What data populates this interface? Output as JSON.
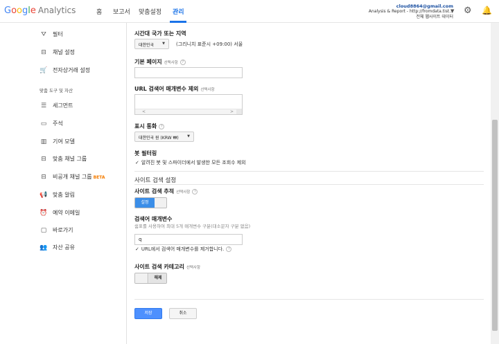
{
  "app": {
    "logo_google": [
      "G",
      "o",
      "o",
      "g",
      "l",
      "e"
    ],
    "product": "Analytics"
  },
  "nav": {
    "home": "홈",
    "reports": "보고서",
    "customization": "맞춤설정",
    "admin": "관리"
  },
  "account": {
    "email": "cloud8864@gmail.com",
    "line2": "Analysis & Report - http://fromdata.tist...",
    "line3": "전체 웹사이트 데이터"
  },
  "sidebar": {
    "items_top": [
      {
        "label": "필터",
        "icon": "filter-icon",
        "glyph": "⛛"
      },
      {
        "label": "채널 설정",
        "icon": "channel-icon",
        "glyph": "⊟"
      },
      {
        "label": "전자상거래 설정",
        "icon": "cart-icon",
        "glyph": "🛒"
      }
    ],
    "section_header": "맞춤 도구 및 자산",
    "items_bottom": [
      {
        "label": "세그먼트",
        "icon": "segment-icon",
        "glyph": "☰"
      },
      {
        "label": "주석",
        "icon": "annotation-icon",
        "glyph": "▭"
      },
      {
        "label": "기여 모델",
        "icon": "attribution-icon",
        "glyph": "▥"
      },
      {
        "label": "맞춤 채널 그룹",
        "icon": "channel-group-icon",
        "glyph": "⊟"
      },
      {
        "label": "비공개 채널 그룹",
        "icon": "private-channel-icon",
        "glyph": "⊟",
        "badge": "BETA"
      },
      {
        "label": "맞춤 알림",
        "icon": "alert-icon",
        "glyph": "📢"
      },
      {
        "label": "예약 이메일",
        "icon": "clock-icon",
        "glyph": "⏰"
      },
      {
        "label": "바로가기",
        "icon": "shortcut-icon",
        "glyph": "▢"
      },
      {
        "label": "자산 공유",
        "icon": "share-icon",
        "glyph": "👥"
      }
    ]
  },
  "form": {
    "timezone": {
      "label": "시간대 국가 또는 지역",
      "country": "대한민국",
      "zone": "(그리니치 표준시 +09:00) 서울"
    },
    "default_page": {
      "label": "기본 페이지",
      "optional": "선택사항",
      "value": ""
    },
    "exclude_params": {
      "label": "URL 검색어 매개변수 제외",
      "optional": "선택사항"
    },
    "currency": {
      "label": "표시 통화",
      "value": "대한민국 원 (KRW ₩)"
    },
    "bot": {
      "label": "봇 필터링",
      "checkbox": "알려진 봇 및 스파이더에서 발생한 모든 조회수 제외"
    },
    "site_search_section": "사이트 검색 설정",
    "site_search_tracking": {
      "label": "사이트 검색 추적",
      "optional": "선택사항",
      "state": "설정"
    },
    "query_param": {
      "label": "검색어 매개변수",
      "desc": "쉼표를 사용하여 최대 5개 매개변수 구분(대소문자 구분 없음)",
      "value": "q",
      "checkbox": "URL에서 검색어 매개변수를 제거합니다."
    },
    "site_search_category": {
      "label": "사이트 검색 카테고리",
      "optional": "선택사항",
      "state": "해제"
    },
    "save": "저장",
    "cancel": "취소"
  }
}
